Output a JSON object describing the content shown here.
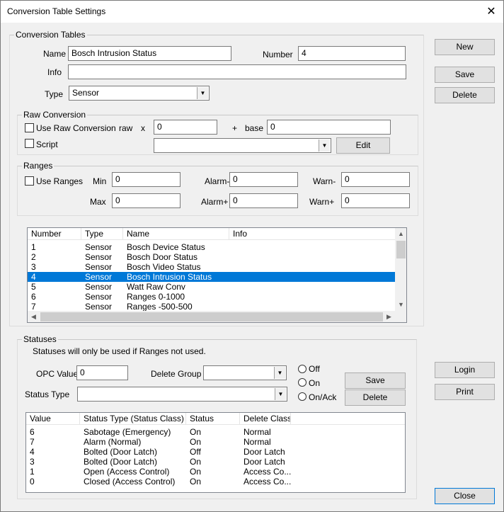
{
  "window": {
    "title": "Conversion Table Settings",
    "close_glyph": "✕"
  },
  "conversion_tables": {
    "legend": "Conversion Tables",
    "name_label": "Name",
    "name_value": "Bosch Intrusion Status",
    "number_label": "Number",
    "number_value": "4",
    "info_label": "Info",
    "info_value": "",
    "type_label": "Type",
    "type_value": "Sensor"
  },
  "raw_conversion": {
    "legend": "Raw Conversion",
    "use_raw_label": "Use Raw Conversion",
    "use_raw_checked": false,
    "raw_label": "raw",
    "x_label": "x",
    "multiplier_value": "0",
    "plus_label": "+",
    "base_label": "base",
    "base_value": "0",
    "script_label": "Script",
    "script_checked": false,
    "script_value": "",
    "edit_label": "Edit"
  },
  "ranges": {
    "legend": "Ranges",
    "use_ranges_label": "Use Ranges",
    "use_ranges_checked": false,
    "min_label": "Min",
    "min_value": "0",
    "max_label": "Max",
    "max_value": "0",
    "alarm_minus_label": "Alarm-",
    "alarm_minus_value": "0",
    "alarm_plus_label": "Alarm+",
    "alarm_plus_value": "0",
    "warn_minus_label": "Warn-",
    "warn_minus_value": "0",
    "warn_plus_label": "Warn+",
    "warn_plus_value": "0"
  },
  "tables_list": {
    "columns": [
      "Number",
      "Type",
      "Name",
      "Info"
    ],
    "rows": [
      [
        "1",
        "Sensor",
        "Bosch Device Status",
        ""
      ],
      [
        "2",
        "Sensor",
        "Bosch Door Status",
        ""
      ],
      [
        "3",
        "Sensor",
        "Bosch Video Status",
        ""
      ],
      [
        "4",
        "Sensor",
        "Bosch Intrusion Status",
        ""
      ],
      [
        "5",
        "Sensor",
        "Watt Raw Conv",
        ""
      ],
      [
        "6",
        "Sensor",
        "Ranges 0-1000",
        ""
      ],
      [
        "7",
        "Sensor",
        "Ranges -500-500",
        ""
      ]
    ],
    "selected_row": "4"
  },
  "statuses": {
    "legend": "Statuses",
    "note": "Statuses will only be used if Ranges not used.",
    "opc_label": "OPC Value",
    "opc_value": "0",
    "delete_group_label": "Delete Group",
    "delete_group_value": "",
    "status_type_label": "Status Type",
    "status_type_value": "",
    "radio_off": "Off",
    "radio_on": "On",
    "radio_onack": "On/Ack",
    "save_label": "Save",
    "delete_label": "Delete",
    "columns": [
      "Value",
      "Status Type (Status Class)",
      "Status",
      "Delete Class"
    ],
    "rows": [
      [
        "6",
        "Sabotage (Emergency)",
        "On",
        "Normal"
      ],
      [
        "7",
        "Alarm (Normal)",
        "On",
        "Normal"
      ],
      [
        "4",
        "Bolted (Door Latch)",
        "Off",
        "Door Latch"
      ],
      [
        "3",
        "Bolted (Door Latch)",
        "On",
        "Door Latch"
      ],
      [
        "1",
        "Open (Access Control)",
        "On",
        "Access Co..."
      ],
      [
        "0",
        "Closed (Access Control)",
        "On",
        "Access Co..."
      ]
    ]
  },
  "side_buttons": {
    "new": "New",
    "save": "Save",
    "delete": "Delete",
    "login": "Login",
    "print": "Print",
    "close": "Close"
  },
  "icons": {
    "dropdown": "chevron-down-icon",
    "scroll_up": "▲",
    "scroll_down": "▼",
    "scroll_left": "◀",
    "scroll_right": "▶"
  },
  "colors": {
    "selection": "#0078d7",
    "window_bg": "#f0f0f0"
  }
}
